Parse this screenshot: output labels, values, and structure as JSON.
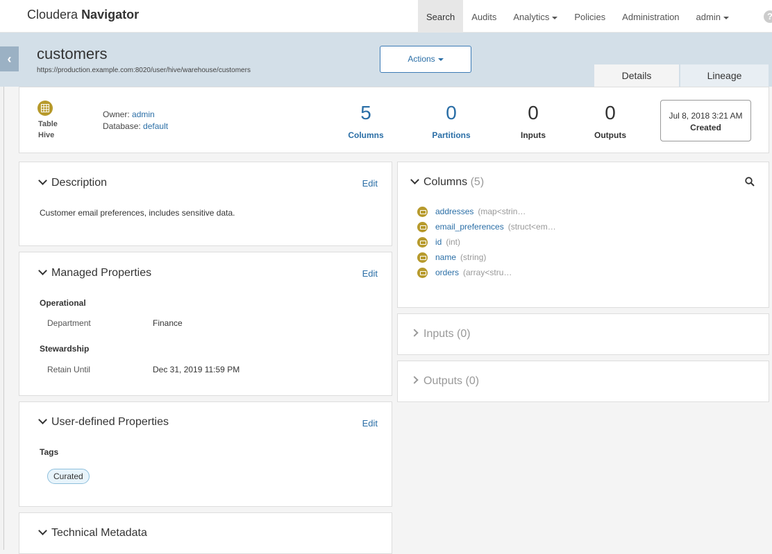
{
  "app": {
    "brand_light": "Cloudera",
    "brand_bold": "Navigator"
  },
  "nav": {
    "items": [
      {
        "label": "Search",
        "active": true
      },
      {
        "label": "Audits"
      },
      {
        "label": "Analytics",
        "dropdown": true
      },
      {
        "label": "Policies"
      },
      {
        "label": "Administration"
      },
      {
        "label": "admin",
        "dropdown": true
      }
    ]
  },
  "entity": {
    "name": "customers",
    "path": "https://production.example.com:8020/user/hive/warehouse/customers",
    "actions_label": "Actions",
    "tabs": {
      "details": "Details",
      "lineage": "Lineage"
    },
    "type": "Table",
    "source": "Hive",
    "owner_label": "Owner:",
    "owner": "admin",
    "database_label": "Database:",
    "database": "default"
  },
  "stats": {
    "columns": {
      "value": "5",
      "label": "Columns"
    },
    "partitions": {
      "value": "0",
      "label": "Partitions"
    },
    "inputs": {
      "value": "0",
      "label": "Inputs"
    },
    "outputs": {
      "value": "0",
      "label": "Outputs"
    },
    "created_date": "Jul 8, 2018 3:21 AM",
    "created_label": "Created"
  },
  "description": {
    "title": "Description",
    "edit": "Edit",
    "text": "Customer email preferences, includes sensitive data."
  },
  "managed": {
    "title": "Managed Properties",
    "edit": "Edit",
    "operational": "Operational",
    "department_key": "Department",
    "department_value": "Finance",
    "stewardship": "Stewardship",
    "retain_key": "Retain Until",
    "retain_value": "Dec 31, 2019 11:59 PM"
  },
  "user_defined": {
    "title": "User-defined Properties",
    "edit": "Edit",
    "tags_label": "Tags",
    "tag": "Curated"
  },
  "technical": {
    "title": "Technical Metadata"
  },
  "columns_panel": {
    "title": "Columns",
    "count": "(5)",
    "items": [
      {
        "name": "addresses",
        "type": "(map<strin…"
      },
      {
        "name": "email_preferences",
        "type": "(struct<em…"
      },
      {
        "name": "id",
        "type": "(int)"
      },
      {
        "name": "name",
        "type": "(string)"
      },
      {
        "name": "orders",
        "type": "(array<stru…"
      }
    ]
  },
  "inputs_panel": {
    "title": "Inputs",
    "count": "(0)"
  },
  "outputs_panel": {
    "title": "Outputs",
    "count": "(0)"
  },
  "colors": {
    "accent": "#2a6ea6",
    "header_bg": "#d3dfe8",
    "type_icon": "#b79a2c"
  }
}
